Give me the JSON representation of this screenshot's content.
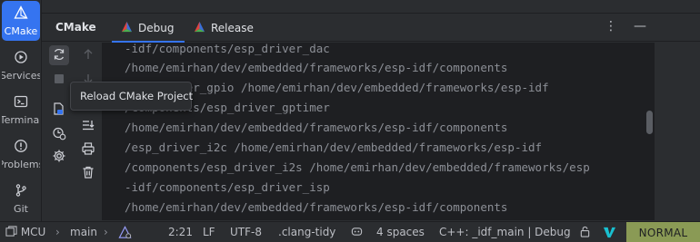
{
  "sidebar": {
    "items": [
      {
        "label": "CMake",
        "icon": "cmake-triangle-icon"
      },
      {
        "label": "Services",
        "icon": "services-play-icon"
      },
      {
        "label": "Terminal",
        "icon": "terminal-icon"
      },
      {
        "label": "Problems",
        "icon": "problems-warning-icon"
      },
      {
        "label": "Git",
        "icon": "git-branch-icon"
      }
    ]
  },
  "toolwindow": {
    "title": "CMake",
    "tabs": [
      {
        "label": "Debug",
        "icon": "cmake-triangle-icon",
        "active": true
      },
      {
        "label": "Release",
        "icon": "cmake-triangle-icon",
        "active": false
      }
    ],
    "more_glyph": "⋮",
    "minimize_glyph": "—"
  },
  "tooltip": {
    "text": "Reload CMake Project"
  },
  "console": {
    "lines": [
      "-idf/components/esp_driver_dac",
      "/home/emirhan/dev/embedded/frameworks/esp-idf/components",
      "/esp_driver_gpio /home/emirhan/dev/embedded/frameworks/esp-idf",
      "/components/esp_driver_gptimer",
      "/home/emirhan/dev/embedded/frameworks/esp-idf/components",
      "/esp_driver_i2c /home/emirhan/dev/embedded/frameworks/esp-idf",
      "/components/esp_driver_i2s /home/emirhan/dev/embedded/frameworks/esp",
      "-idf/components/esp_driver_isp",
      "/home/emirhan/dev/embedded/frameworks/esp-idf/components"
    ]
  },
  "statusbar": {
    "project": "MCU",
    "branch": "main",
    "position": "2:21",
    "line_ending": "LF",
    "encoding": "UTF-8",
    "formatter": ".clang-tidy",
    "indent": "4 spaces",
    "context": "C++: _idf_main | Debug",
    "mode": "NORMAL"
  },
  "colors": {
    "accent": "#3574f0",
    "mode_badge": "#8a9a55",
    "cmake_red": "#e0443e",
    "cmake_green": "#4caf50",
    "cmake_blue": "#3b6fd8"
  }
}
